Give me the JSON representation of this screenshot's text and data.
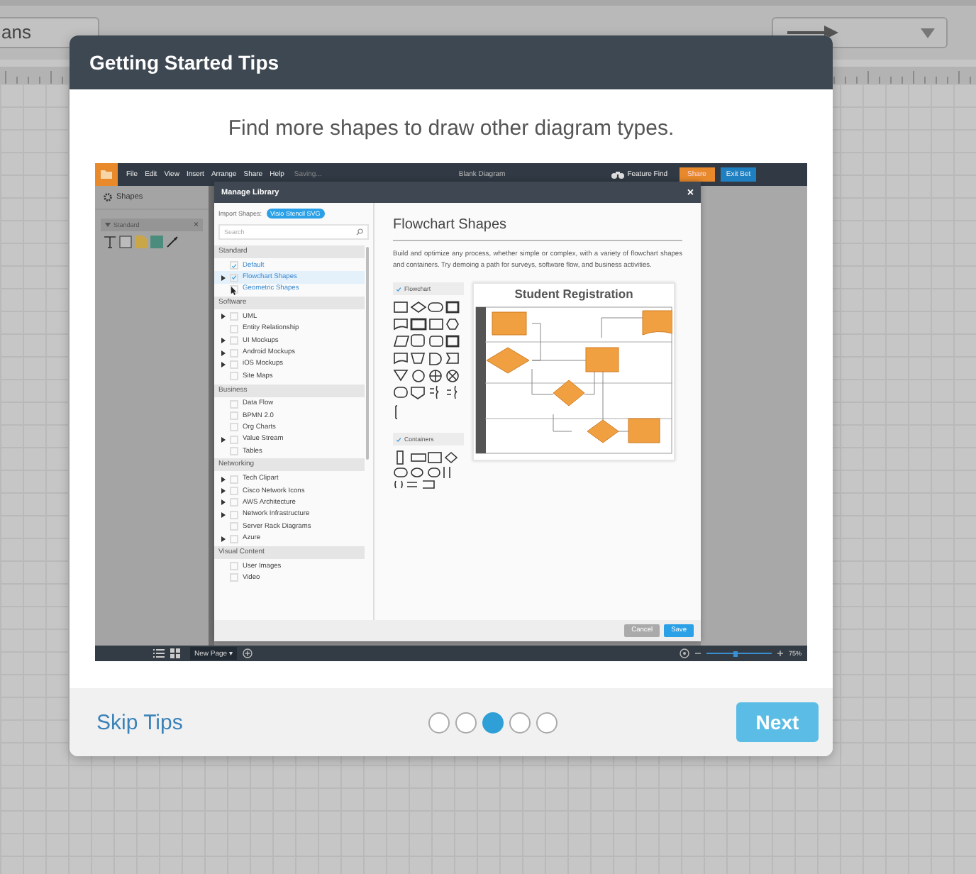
{
  "background_toolbar": {
    "font_field": "ans"
  },
  "dialog": {
    "title": "Getting Started Tips",
    "subtitle": "Find more shapes to draw other diagram types.",
    "screenshot": {
      "menu_bar": {
        "menus": [
          "File",
          "Edit",
          "View",
          "Insert",
          "Arrange",
          "Share",
          "Help"
        ],
        "status": "Saving...",
        "document_title": "Blank Diagram",
        "feature_find": "Feature Find",
        "share": "Share",
        "exit": "Exit Bet"
      },
      "shapes_panel": {
        "title": "Shapes",
        "library_tab": "Standard",
        "close": "×"
      },
      "manage_library": {
        "title": "Manage Library",
        "close": "×",
        "import_label": "Import Shapes:",
        "import_options": [
          "Visio Stencil",
          "SVG"
        ],
        "search_placeholder": "Search",
        "sections": [
          {
            "title": "Standard",
            "items": [
              {
                "label": "Default",
                "checked": true,
                "expandable": false,
                "linked": true,
                "selected": false,
                "cursor": false
              },
              {
                "label": "Flowchart Shapes",
                "checked": true,
                "expandable": true,
                "linked": true,
                "selected": true,
                "cursor": false
              },
              {
                "label": "Geometric Shapes",
                "checked": false,
                "expandable": false,
                "linked": true,
                "selected": false,
                "cursor": true
              }
            ]
          },
          {
            "title": "Software",
            "items": [
              {
                "label": "UML",
                "checked": false,
                "expandable": true,
                "linked": false,
                "selected": false,
                "cursor": false
              },
              {
                "label": "Entity Relationship",
                "checked": false,
                "expandable": false,
                "linked": false,
                "selected": false,
                "cursor": false
              },
              {
                "label": "UI Mockups",
                "checked": false,
                "expandable": true,
                "linked": false,
                "selected": false,
                "cursor": false
              },
              {
                "label": "Android Mockups",
                "checked": false,
                "expandable": true,
                "linked": false,
                "selected": false,
                "cursor": false
              },
              {
                "label": "iOS Mockups",
                "checked": false,
                "expandable": true,
                "linked": false,
                "selected": false,
                "cursor": false
              },
              {
                "label": "Site Maps",
                "checked": false,
                "expandable": false,
                "linked": false,
                "selected": false,
                "cursor": false
              }
            ]
          },
          {
            "title": "Business",
            "items": [
              {
                "label": "Data Flow",
                "checked": false,
                "expandable": false,
                "linked": false,
                "selected": false,
                "cursor": false
              },
              {
                "label": "BPMN 2.0",
                "checked": false,
                "expandable": false,
                "linked": false,
                "selected": false,
                "cursor": false
              },
              {
                "label": "Org Charts",
                "checked": false,
                "expandable": false,
                "linked": false,
                "selected": false,
                "cursor": false
              },
              {
                "label": "Value Stream",
                "checked": false,
                "expandable": true,
                "linked": false,
                "selected": false,
                "cursor": false
              },
              {
                "label": "Tables",
                "checked": false,
                "expandable": false,
                "linked": false,
                "selected": false,
                "cursor": false
              }
            ]
          },
          {
            "title": "Networking",
            "items": [
              {
                "label": "Tech Clipart",
                "checked": false,
                "expandable": true,
                "linked": false,
                "selected": false,
                "cursor": false
              },
              {
                "label": "Cisco Network Icons",
                "checked": false,
                "expandable": true,
                "linked": false,
                "selected": false,
                "cursor": false
              },
              {
                "label": "AWS Architecture",
                "checked": false,
                "expandable": true,
                "linked": false,
                "selected": false,
                "cursor": false
              },
              {
                "label": "Network Infrastructure",
                "checked": false,
                "expandable": true,
                "linked": false,
                "selected": false,
                "cursor": false
              },
              {
                "label": "Server Rack Diagrams",
                "checked": false,
                "expandable": false,
                "linked": false,
                "selected": false,
                "cursor": false
              },
              {
                "label": "Azure",
                "checked": false,
                "expandable": true,
                "linked": false,
                "selected": false,
                "cursor": false
              }
            ]
          },
          {
            "title": "Visual Content",
            "items": [
              {
                "label": "User Images",
                "checked": false,
                "expandable": false,
                "linked": false,
                "selected": false,
                "cursor": false
              },
              {
                "label": "Video",
                "checked": false,
                "expandable": false,
                "linked": false,
                "selected": false,
                "cursor": false
              }
            ]
          }
        ],
        "heading": "Flowchart Shapes",
        "description": "Build and optimize any process, whether simple or complex, with a variety of flowchart shapes and containers. Try demoing a path for surveys, software flow, and business activities.",
        "palette_groups": [
          {
            "label": "Flowchart",
            "checked": true,
            "kind": "flowchart"
          },
          {
            "label": "Containers",
            "checked": true,
            "kind": "containers"
          }
        ],
        "diagram_title": "Student Registration",
        "buttons": [
          {
            "label": "Cancel",
            "kind": "secondary"
          },
          {
            "label": "Save",
            "kind": "primary"
          }
        ]
      },
      "bottom_bar": {
        "page_button": "New Page ▾",
        "level": 0.45,
        "zoom": "75%"
      }
    },
    "skip": "Skip Tips",
    "pager": [
      {
        "selected": false
      },
      {
        "selected": false
      },
      {
        "selected": true
      },
      {
        "selected": false
      },
      {
        "selected": false
      }
    ],
    "next": "Next"
  }
}
